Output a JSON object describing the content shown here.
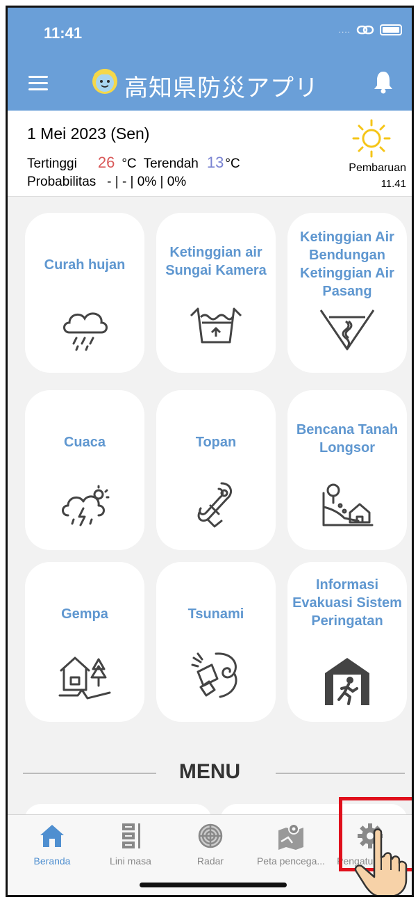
{
  "status_bar": {
    "time": "11:41",
    "dots": "....",
    "icons": [
      "link-icon",
      "battery-icon"
    ]
  },
  "header": {
    "title": "高知県防災アプリ",
    "menu_icon": "hamburger-icon",
    "logo": "mascot-logo",
    "notification_icon": "bell-icon"
  },
  "weather": {
    "date": "1 Mei 2023 (Sen)",
    "high_label": "Tertinggi",
    "high_value": "26",
    "high_unit": "°C",
    "low_label": "Terendah",
    "low_value": "13",
    "low_unit": "°C",
    "prob_label": "Probabilitas",
    "prob_values": "- | - | 0% | 0%",
    "update_label": "Pembaruan",
    "update_time": "11.41",
    "icon": "sun-icon",
    "colors": {
      "high": "#d95a5a",
      "low": "#7a84d2"
    }
  },
  "tiles": [
    {
      "label": "Curah hujan",
      "icon": "rain-cloud-icon"
    },
    {
      "label": "Ketinggian air Sungai Kamera",
      "icon": "river-level-icon"
    },
    {
      "label": "Ketinggian Air Bendungan Ketinggian Air Pasang",
      "icon": "dam-level-icon"
    },
    {
      "label": "Cuaca",
      "icon": "thunderstorm-icon"
    },
    {
      "label": "Topan",
      "icon": "typhoon-icon"
    },
    {
      "label": "Bencana Tanah Longsor",
      "icon": "landslide-icon"
    },
    {
      "label": "Gempa",
      "icon": "earthquake-icon"
    },
    {
      "label": "Tsunami",
      "icon": "tsunami-icon"
    },
    {
      "label": "Informasi Evakuasi Sistem Peringatan",
      "icon": "evacuation-icon"
    }
  ],
  "menu": {
    "title": "MENU"
  },
  "tabbar": {
    "items": [
      {
        "label": "Beranda",
        "icon": "home-icon",
        "active": true
      },
      {
        "label": "Lini masa",
        "icon": "timeline-icon",
        "active": false
      },
      {
        "label": "Radar",
        "icon": "radar-icon",
        "active": false
      },
      {
        "label": "Peta pencega...",
        "icon": "map-icon",
        "active": false
      },
      {
        "label": "Pengaturan p...",
        "icon": "gear-icon",
        "active": false
      }
    ],
    "colors": {
      "active": "#4f8fd0",
      "inactive": "#888888"
    }
  },
  "colors": {
    "header": "#6a9fd8",
    "tile_text": "#5f97d0",
    "highlight": "#e0101c"
  }
}
